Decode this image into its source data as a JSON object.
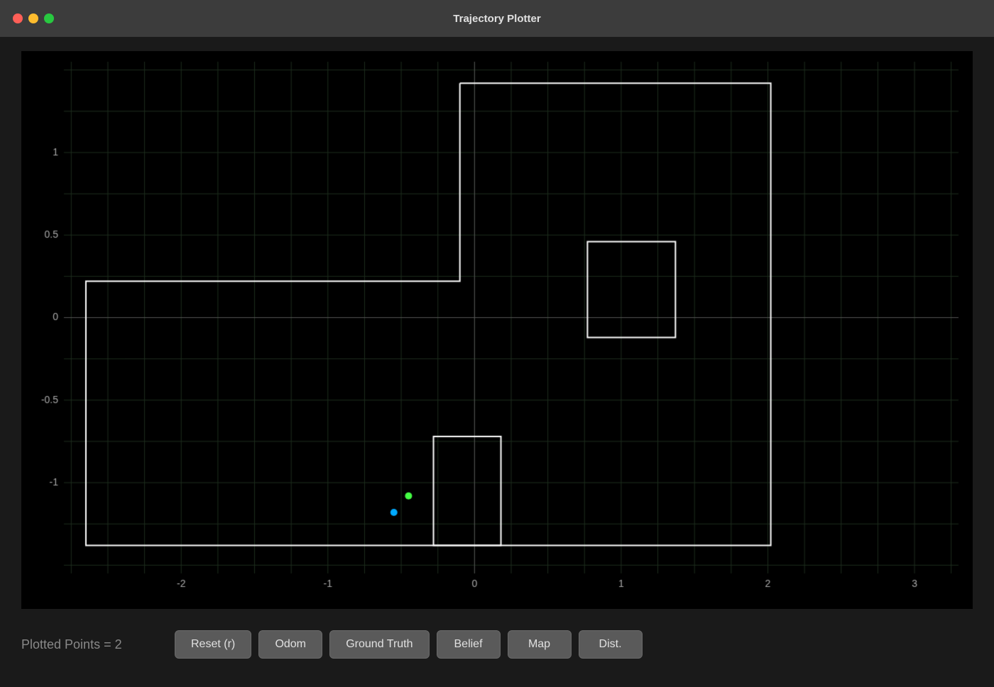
{
  "titleBar": {
    "title": "Trajectory Plotter"
  },
  "controls": {
    "plottedPointsLabel": "Plotted Points = 2",
    "buttons": [
      {
        "id": "reset",
        "label": "Reset (r)"
      },
      {
        "id": "odom",
        "label": "Odom"
      },
      {
        "id": "ground-truth",
        "label": "Ground Truth"
      },
      {
        "id": "belief",
        "label": "Belief"
      },
      {
        "id": "map",
        "label": "Map"
      },
      {
        "id": "dist",
        "label": "Dist."
      }
    ]
  },
  "plot": {
    "xMin": -2.8,
    "xMax": 3.3,
    "yMin": -1.55,
    "yMax": 1.55,
    "gridColor": "#2a3a2a",
    "axisColor": "#aaa",
    "tickColor": "#aaa",
    "xTicks": [
      -2,
      -1,
      0,
      1,
      2,
      3
    ],
    "yTicks": [
      -1,
      -0.5,
      0,
      0.5,
      1
    ],
    "points": [
      {
        "x": -0.55,
        "y": -1.18,
        "color": "#00aaff",
        "radius": 5
      },
      {
        "x": -0.45,
        "y": -1.08,
        "color": "#44ff44",
        "radius": 5
      }
    ],
    "rectangles": [
      {
        "comment": "large L-shape outer boundary - top portion",
        "type": "polyline",
        "points": [
          [
            -0.1,
            1.4
          ],
          [
            2.0,
            1.4
          ],
          [
            2.0,
            -1.35
          ],
          [
            -2.65,
            -1.35
          ],
          [
            -2.65,
            0.2
          ],
          [
            -0.1,
            0.2
          ],
          [
            -0.1,
            1.4
          ]
        ]
      },
      {
        "comment": "small rectangle bottom center",
        "type": "rect",
        "x1": -0.3,
        "y1": -0.75,
        "x2": 0.2,
        "y2": -1.35
      },
      {
        "comment": "medium rectangle right",
        "type": "rect",
        "x1": 0.75,
        "y1": 0.45,
        "x2": 1.35,
        "y2": -0.1
      }
    ]
  }
}
